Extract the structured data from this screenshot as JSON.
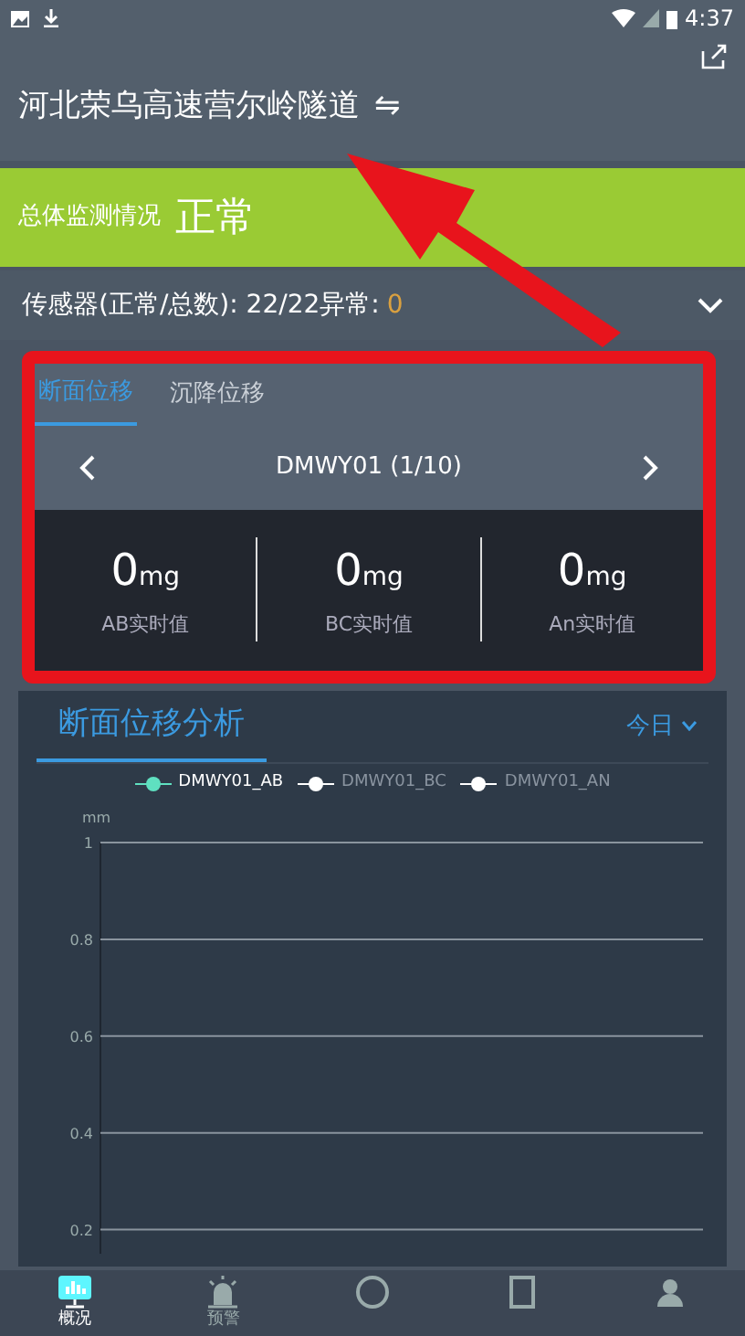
{
  "status_bar": {
    "time": "4:37"
  },
  "header": {
    "title": "河北荣乌高速营尔岭隧道",
    "swap_icon": "⇋"
  },
  "overall": {
    "label": "总体监测情况",
    "value": "正常"
  },
  "sensors": {
    "label": "传感器(正常/总数): 22/22异常:",
    "abnormal": "0",
    "expanded": false
  },
  "tabs": [
    {
      "label": "断面位移",
      "selected": true
    },
    {
      "label": "沉降位移",
      "selected": false
    }
  ],
  "device": {
    "name": "DMWY01 (1/10)"
  },
  "readings": [
    {
      "value": "0",
      "unit": "mg",
      "label": "AB实时值"
    },
    {
      "value": "0",
      "unit": "mg",
      "label": "BC实时值"
    },
    {
      "value": "0",
      "unit": "mg",
      "label": "An实时值"
    }
  ],
  "analysis": {
    "title": "断面位移分析",
    "range": "今日",
    "legend_states": [
      {
        "selected": true
      },
      {
        "selected": false
      },
      {
        "selected": false
      }
    ],
    "chart_data": {
      "type": "line",
      "grid": true,
      "ylabel": "mm",
      "ylim": [
        0.15,
        1
      ],
      "yticks": [
        0.2,
        0.4,
        0.6,
        0.8,
        {
          "value": 1,
          "label": "1"
        }
      ],
      "series": [
        {
          "name": "DMWY01_AB",
          "color": "#5fe0c0"
        },
        {
          "name": "DMWY01_BC",
          "color": "#ffffff"
        },
        {
          "name": "DMWY01_AN",
          "color": "#ffffff"
        }
      ]
    }
  },
  "bottom_nav": [
    {
      "label": "概况",
      "selected": true,
      "kind": "chart"
    },
    {
      "label": "预警",
      "selected": false,
      "kind": "alarm"
    },
    {
      "selected": false,
      "kind": "gauge"
    },
    {
      "selected": false,
      "kind": "doc"
    },
    {
      "selected": false,
      "kind": "user"
    }
  ]
}
